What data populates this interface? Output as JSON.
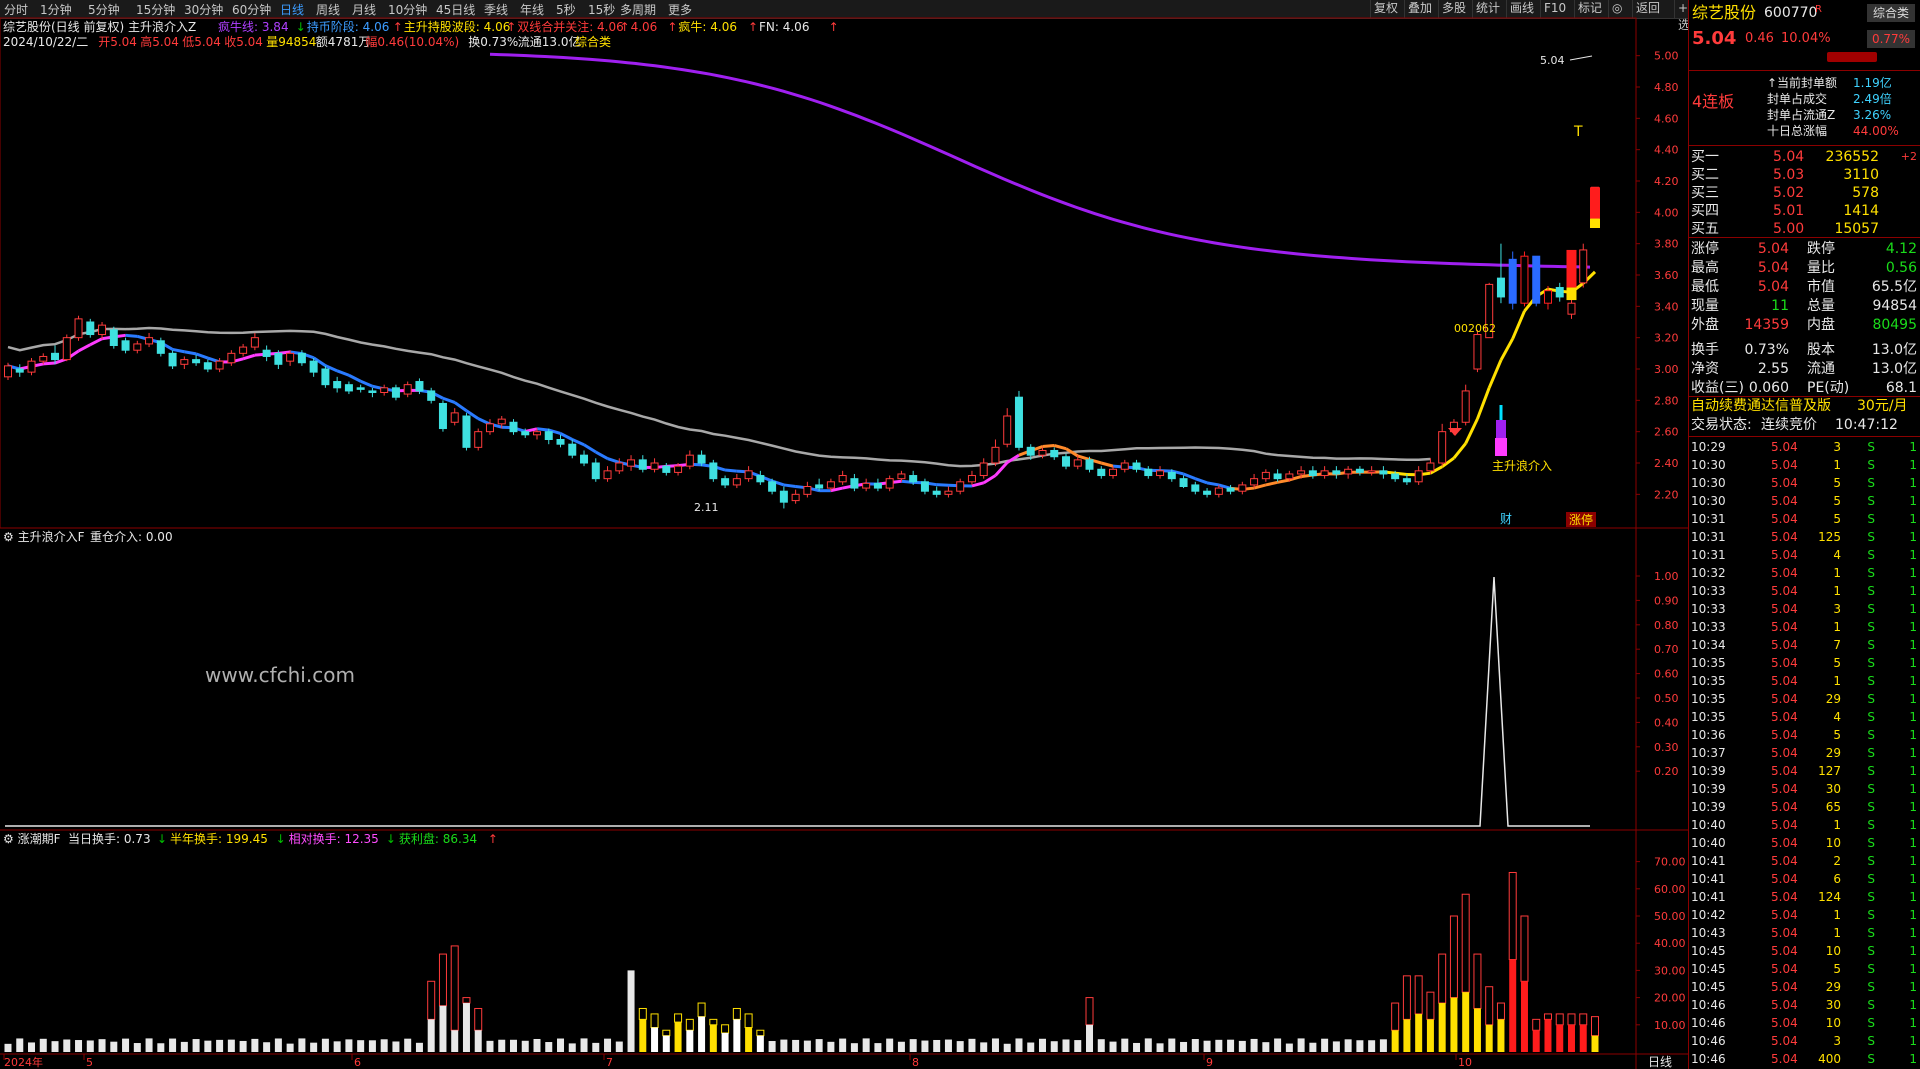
{
  "toolbar": {
    "periods": [
      "分时",
      "1分钟",
      "5分钟",
      "15分钟",
      "30分钟",
      "60分钟",
      "日线",
      "周线",
      "月线",
      "10分钟",
      "45日线",
      "季线",
      "年线",
      "5秒",
      "15秒",
      "多周期",
      "更多"
    ],
    "active_period": "日线",
    "right_buttons": [
      "复权",
      "叠加",
      "多股",
      "统计",
      "画线",
      "F10",
      "标记",
      "◎",
      "返回"
    ],
    "zixuan": "+自选"
  },
  "main_panel": {
    "title": "综艺股份(日线 前复权)",
    "indicator_name": "主升浪介入Z",
    "legend": [
      {
        "label": "疯牛线: 3.84",
        "color": "#b040ff"
      },
      {
        "label": "↓",
        "color": "#00c000"
      },
      {
        "label": "持币阶段: 4.06",
        "color": "#3c9cff"
      },
      {
        "label": "↑",
        "color": "#ff3b3b"
      },
      {
        "label": "主升持股波段: 4.06",
        "color": "#ffe000"
      },
      {
        "label": "↑",
        "color": "#ff3b3b"
      },
      {
        "label": "双线合并关注: 4.06",
        "color": "#ff3b3b"
      },
      {
        "label": "↑",
        "color": "#ff3b3b"
      },
      {
        "label": "4.06",
        "color": "#ff3b3b"
      },
      {
        "label": "↑",
        "color": "#ff3b3b"
      },
      {
        "label": "疯牛: 4.06",
        "color": "#ffe000"
      },
      {
        "label": "↑",
        "color": "#ff3b3b"
      },
      {
        "label": "FN: 4.06",
        "color": "#e8e8e8"
      },
      {
        "label": "↑",
        "color": "#ff3b3b"
      }
    ],
    "info_line": [
      {
        "label": "2024/10/22/二",
        "color": "#e8e8e8"
      },
      {
        "label": "开5.04",
        "color": "#ff3b3b"
      },
      {
        "label": "高5.04",
        "color": "#ff3b3b"
      },
      {
        "label": "低5.04",
        "color": "#ff3b3b"
      },
      {
        "label": "收5.04",
        "color": "#ff3b3b"
      },
      {
        "label": "量94854",
        "color": "#ffe000"
      },
      {
        "label": "额4781万",
        "color": "#e8e8e8"
      },
      {
        "label": "幅0.46(10.04%)",
        "color": "#ff3b3b"
      },
      {
        "label": "换0.73%",
        "color": "#e8e8e8"
      },
      {
        "label": "流通13.0亿",
        "color": "#e8e8e8"
      },
      {
        "label": "综合类",
        "color": "#ffe000"
      }
    ],
    "yaxis": [
      "5.00",
      "4.80",
      "4.60",
      "4.40",
      "4.20",
      "4.00",
      "3.80",
      "3.60",
      "3.40",
      "3.20",
      "3.00",
      "2.80",
      "2.60",
      "2.40",
      "2.20"
    ],
    "annotations": {
      "high_label": "5.04",
      "low_label": "2.11",
      "mid_label": "002062",
      "signal_label": "主升浪介入",
      "cai": "财",
      "zhangting": "涨停"
    }
  },
  "panel2": {
    "title": "主升浪介入F",
    "legend": "重仓介入: 0.00",
    "yaxis": [
      "1.00",
      "0.90",
      "0.80",
      "0.70",
      "0.60",
      "0.50",
      "0.40",
      "0.30",
      "0.20"
    ],
    "watermark": "www.cfchi.com",
    "peak_value": 1.0
  },
  "panel3": {
    "title": "涨潮期F",
    "legend": [
      {
        "label": "当日换手: 0.73",
        "color": "#e8e8e8"
      },
      {
        "label": "↓",
        "color": "#00c000"
      },
      {
        "label": "半年换手: 199.45",
        "color": "#ffe000"
      },
      {
        "label": "↓",
        "color": "#00c000"
      },
      {
        "label": "相对换手: 12.35",
        "color": "#ff4cff"
      },
      {
        "label": "↓",
        "color": "#00c000"
      },
      {
        "label": "获利盘: 86.34",
        "color": "#1adc1a"
      },
      {
        "label": "↑",
        "color": "#ff3b3b"
      }
    ],
    "yaxis": [
      "70.00",
      "60.00",
      "50.00",
      "40.00",
      "30.00",
      "20.00",
      "10.00"
    ],
    "xaxis": [
      {
        "label": "2024年",
        "pos": 0
      },
      {
        "label": "5",
        "pos": 1
      },
      {
        "label": "6",
        "pos": 2
      },
      {
        "label": "7",
        "pos": 3
      },
      {
        "label": "8",
        "pos": 4
      },
      {
        "label": "9",
        "pos": 5
      },
      {
        "label": "10",
        "pos": 6
      }
    ],
    "xaxis_right": "日线"
  },
  "quote": {
    "name": "综艺股份",
    "code": "600770",
    "code_flag": "R",
    "badge": "综合类",
    "price": "5.04",
    "change": "0.46",
    "pct": "10.04%",
    "badge_pct": "0.77%",
    "lianban": "4连板",
    "seal": [
      {
        "k": "当前封单额",
        "v": "1.19亿",
        "c": "cyan"
      },
      {
        "k": "封单占成交",
        "v": "2.49倍",
        "c": "cyan"
      },
      {
        "k": "封单占流通Z",
        "v": "3.26%",
        "c": "cyan"
      },
      {
        "k": "十日总涨幅",
        "v": "44.00%",
        "c": "red"
      }
    ],
    "bids": [
      {
        "k": "买一",
        "p": "5.04",
        "v": "236552",
        "d": "+2"
      },
      {
        "k": "买二",
        "p": "5.03",
        "v": "3110",
        "d": ""
      },
      {
        "k": "买三",
        "p": "5.02",
        "v": "578",
        "d": ""
      },
      {
        "k": "买四",
        "p": "5.01",
        "v": "1414",
        "d": ""
      },
      {
        "k": "买五",
        "p": "5.00",
        "v": "15057",
        "d": ""
      }
    ],
    "stats": [
      {
        "k1": "涨停",
        "v1": "5.04",
        "c1": "red",
        "k2": "跌停",
        "v2": "4.12",
        "c2": "green"
      },
      {
        "k1": "最高",
        "v1": "5.04",
        "c1": "red",
        "k2": "量比",
        "v2": "0.56",
        "c2": "green"
      },
      {
        "k1": "最低",
        "v1": "5.04",
        "c1": "red",
        "k2": "市值",
        "v2": "65.5亿",
        "c2": "white"
      },
      {
        "k1": "现量",
        "v1": "11",
        "c1": "green",
        "k2": "总量",
        "v2": "94854",
        "c2": "white"
      },
      {
        "k1": "外盘",
        "v1": "14359",
        "c1": "red",
        "k2": "内盘",
        "v2": "80495",
        "c2": "green"
      },
      {
        "k1": "换手",
        "v1": "0.73%",
        "c1": "white",
        "k2": "股本",
        "v2": "13.0亿",
        "c2": "white"
      },
      {
        "k1": "净资",
        "v1": "2.55",
        "c1": "white",
        "k2": "流通",
        "v2": "13.0亿",
        "c2": "white"
      },
      {
        "k1": "收益(三)",
        "v1": "0.060",
        "c1": "white",
        "k2": "PE(动)",
        "v2": "68.1",
        "c2": "white"
      }
    ],
    "promo": "自动续费通达信普及版",
    "promo_price": "30元/月",
    "trade_state_label": "交易状态:",
    "trade_state": "连续竞价",
    "trade_time": "10:47:12",
    "ticks": [
      [
        "10:29",
        "5.04",
        "3",
        "S",
        "1"
      ],
      [
        "10:30",
        "5.04",
        "1",
        "S",
        "1"
      ],
      [
        "10:30",
        "5.04",
        "5",
        "S",
        "1"
      ],
      [
        "10:30",
        "5.04",
        "5",
        "S",
        "1"
      ],
      [
        "10:31",
        "5.04",
        "5",
        "S",
        "1"
      ],
      [
        "10:31",
        "5.04",
        "125",
        "S",
        "1"
      ],
      [
        "10:31",
        "5.04",
        "4",
        "S",
        "1"
      ],
      [
        "10:32",
        "5.04",
        "1",
        "S",
        "1"
      ],
      [
        "10:33",
        "5.04",
        "1",
        "S",
        "1"
      ],
      [
        "10:33",
        "5.04",
        "3",
        "S",
        "1"
      ],
      [
        "10:33",
        "5.04",
        "1",
        "S",
        "1"
      ],
      [
        "10:34",
        "5.04",
        "7",
        "S",
        "1"
      ],
      [
        "10:35",
        "5.04",
        "5",
        "S",
        "1"
      ],
      [
        "10:35",
        "5.04",
        "1",
        "S",
        "1"
      ],
      [
        "10:35",
        "5.04",
        "29",
        "S",
        "1"
      ],
      [
        "10:35",
        "5.04",
        "4",
        "S",
        "1"
      ],
      [
        "10:36",
        "5.04",
        "5",
        "S",
        "1"
      ],
      [
        "10:37",
        "5.04",
        "29",
        "S",
        "1"
      ],
      [
        "10:39",
        "5.04",
        "127",
        "S",
        "1"
      ],
      [
        "10:39",
        "5.04",
        "30",
        "S",
        "1"
      ],
      [
        "10:39",
        "5.04",
        "65",
        "S",
        "1"
      ],
      [
        "10:40",
        "5.04",
        "1",
        "S",
        "1"
      ],
      [
        "10:40",
        "5.04",
        "10",
        "S",
        "1"
      ],
      [
        "10:41",
        "5.04",
        "2",
        "S",
        "1"
      ],
      [
        "10:41",
        "5.04",
        "6",
        "S",
        "1"
      ],
      [
        "10:41",
        "5.04",
        "124",
        "S",
        "1"
      ],
      [
        "10:42",
        "5.04",
        "1",
        "S",
        "1"
      ],
      [
        "10:43",
        "5.04",
        "1",
        "S",
        "1"
      ],
      [
        "10:45",
        "5.04",
        "10",
        "S",
        "1"
      ],
      [
        "10:45",
        "5.04",
        "5",
        "S",
        "1"
      ],
      [
        "10:45",
        "5.04",
        "29",
        "S",
        "1"
      ],
      [
        "10:46",
        "5.04",
        "30",
        "S",
        "1"
      ],
      [
        "10:46",
        "5.04",
        "10",
        "S",
        "1"
      ],
      [
        "10:46",
        "5.04",
        "3",
        "S",
        "1"
      ],
      [
        "10:46",
        "5.04",
        "400",
        "S",
        "1"
      ]
    ]
  },
  "chart_data": {
    "type": "candlestick",
    "ylim": [
      2.1,
      5.1
    ],
    "candles": [
      [
        2.95,
        3.02,
        3.04,
        2.93
      ],
      [
        3.0,
        2.98,
        3.03,
        2.95
      ],
      [
        2.98,
        3.05,
        3.07,
        2.96
      ],
      [
        3.05,
        3.08,
        3.1,
        3.03
      ],
      [
        3.1,
        3.06,
        3.15,
        3.03
      ],
      [
        3.06,
        3.2,
        3.22,
        3.05
      ],
      [
        3.2,
        3.32,
        3.34,
        3.18
      ],
      [
        3.3,
        3.22,
        3.32,
        3.2
      ],
      [
        3.22,
        3.28,
        3.3,
        3.19
      ],
      [
        3.25,
        3.15,
        3.27,
        3.13
      ],
      [
        3.18,
        3.12,
        3.2,
        3.1
      ],
      [
        3.12,
        3.16,
        3.18,
        3.1
      ],
      [
        3.16,
        3.2,
        3.23,
        3.14
      ],
      [
        3.18,
        3.1,
        3.2,
        3.08
      ],
      [
        3.1,
        3.02,
        3.12,
        3.0
      ],
      [
        3.03,
        3.06,
        3.08,
        3.0
      ],
      [
        3.06,
        3.04,
        3.09,
        3.02
      ],
      [
        3.04,
        3.0,
        3.06,
        2.98
      ],
      [
        3.0,
        3.05,
        3.07,
        2.98
      ],
      [
        3.04,
        3.1,
        3.12,
        3.02
      ],
      [
        3.1,
        3.14,
        3.16,
        3.08
      ],
      [
        3.14,
        3.2,
        3.23,
        3.12
      ],
      [
        3.12,
        3.08,
        3.15,
        3.05
      ],
      [
        3.1,
        3.03,
        3.12,
        3.0
      ],
      [
        3.05,
        3.1,
        3.12,
        3.02
      ],
      [
        3.1,
        3.04,
        3.12,
        3.02
      ],
      [
        3.05,
        2.98,
        3.07,
        2.95
      ],
      [
        3.0,
        2.9,
        3.02,
        2.88
      ],
      [
        2.92,
        2.88,
        2.95,
        2.85
      ],
      [
        2.9,
        2.86,
        2.92,
        2.84
      ],
      [
        2.88,
        2.87,
        2.9,
        2.85
      ],
      [
        2.86,
        2.85,
        2.88,
        2.82
      ],
      [
        2.85,
        2.88,
        2.9,
        2.83
      ],
      [
        2.88,
        2.82,
        2.9,
        2.8
      ],
      [
        2.84,
        2.9,
        2.92,
        2.82
      ],
      [
        2.92,
        2.86,
        2.94,
        2.84
      ],
      [
        2.86,
        2.8,
        2.88,
        2.78
      ],
      [
        2.78,
        2.62,
        2.8,
        2.6
      ],
      [
        2.66,
        2.72,
        2.75,
        2.64
      ],
      [
        2.7,
        2.5,
        2.72,
        2.48
      ],
      [
        2.5,
        2.6,
        2.62,
        2.48
      ],
      [
        2.6,
        2.65,
        2.68,
        2.58
      ],
      [
        2.65,
        2.68,
        2.7,
        2.62
      ],
      [
        2.66,
        2.6,
        2.68,
        2.58
      ],
      [
        2.6,
        2.58,
        2.62,
        2.56
      ],
      [
        2.58,
        2.6,
        2.62,
        2.55
      ],
      [
        2.6,
        2.55,
        2.62,
        2.52
      ],
      [
        2.55,
        2.52,
        2.58,
        2.5
      ],
      [
        2.52,
        2.45,
        2.55,
        2.43
      ],
      [
        2.45,
        2.4,
        2.48,
        2.38
      ],
      [
        2.4,
        2.3,
        2.43,
        2.28
      ],
      [
        2.3,
        2.35,
        2.38,
        2.28
      ],
      [
        2.35,
        2.4,
        2.43,
        2.33
      ],
      [
        2.38,
        2.42,
        2.45,
        2.35
      ],
      [
        2.42,
        2.36,
        2.45,
        2.34
      ],
      [
        2.36,
        2.4,
        2.43,
        2.34
      ],
      [
        2.38,
        2.34,
        2.4,
        2.32
      ],
      [
        2.34,
        2.38,
        2.4,
        2.32
      ],
      [
        2.38,
        2.45,
        2.48,
        2.36
      ],
      [
        2.45,
        2.4,
        2.48,
        2.38
      ],
      [
        2.4,
        2.3,
        2.42,
        2.28
      ],
      [
        2.3,
        2.26,
        2.32,
        2.24
      ],
      [
        2.26,
        2.3,
        2.33,
        2.24
      ],
      [
        2.3,
        2.35,
        2.38,
        2.28
      ],
      [
        2.32,
        2.28,
        2.35,
        2.26
      ],
      [
        2.28,
        2.22,
        2.3,
        2.2
      ],
      [
        2.22,
        2.15,
        2.25,
        2.11
      ],
      [
        2.16,
        2.2,
        2.23,
        2.14
      ],
      [
        2.2,
        2.25,
        2.28,
        2.18
      ],
      [
        2.26,
        2.24,
        2.3,
        2.22
      ],
      [
        2.24,
        2.28,
        2.3,
        2.22
      ],
      [
        2.28,
        2.32,
        2.35,
        2.26
      ],
      [
        2.3,
        2.24,
        2.33,
        2.22
      ],
      [
        2.24,
        2.27,
        2.3,
        2.22
      ],
      [
        2.27,
        2.24,
        2.3,
        2.22
      ],
      [
        2.24,
        2.3,
        2.32,
        2.22
      ],
      [
        2.3,
        2.33,
        2.35,
        2.28
      ],
      [
        2.32,
        2.28,
        2.35,
        2.26
      ],
      [
        2.28,
        2.22,
        2.3,
        2.2
      ],
      [
        2.22,
        2.2,
        2.25,
        2.18
      ],
      [
        2.2,
        2.22,
        2.25,
        2.18
      ],
      [
        2.22,
        2.28,
        2.3,
        2.2
      ],
      [
        2.28,
        2.32,
        2.35,
        2.26
      ],
      [
        2.32,
        2.4,
        2.43,
        2.3
      ],
      [
        2.4,
        2.5,
        2.55,
        2.38
      ],
      [
        2.52,
        2.7,
        2.75,
        2.5
      ],
      [
        2.82,
        2.5,
        2.86,
        2.48
      ],
      [
        2.5,
        2.45,
        2.52,
        2.42
      ],
      [
        2.45,
        2.48,
        2.5,
        2.43
      ],
      [
        2.48,
        2.44,
        2.5,
        2.42
      ],
      [
        2.44,
        2.38,
        2.46,
        2.36
      ],
      [
        2.38,
        2.42,
        2.45,
        2.36
      ],
      [
        2.42,
        2.36,
        2.44,
        2.34
      ],
      [
        2.36,
        2.32,
        2.38,
        2.3
      ],
      [
        2.32,
        2.36,
        2.38,
        2.3
      ],
      [
        2.36,
        2.4,
        2.42,
        2.34
      ],
      [
        2.4,
        2.36,
        2.42,
        2.34
      ],
      [
        2.36,
        2.32,
        2.38,
        2.3
      ],
      [
        2.32,
        2.35,
        2.38,
        2.3
      ],
      [
        2.34,
        2.3,
        2.36,
        2.28
      ],
      [
        2.3,
        2.25,
        2.32,
        2.24
      ],
      [
        2.26,
        2.22,
        2.28,
        2.2
      ],
      [
        2.22,
        2.2,
        2.24,
        2.18
      ],
      [
        2.2,
        2.24,
        2.26,
        2.18
      ],
      [
        2.24,
        2.22,
        2.26,
        2.2
      ],
      [
        2.22,
        2.26,
        2.28,
        2.2
      ],
      [
        2.26,
        2.3,
        2.33,
        2.24
      ],
      [
        2.3,
        2.34,
        2.36,
        2.28
      ],
      [
        2.33,
        2.3,
        2.36,
        2.28
      ],
      [
        2.3,
        2.33,
        2.35,
        2.28
      ],
      [
        2.33,
        2.35,
        2.38,
        2.3
      ],
      [
        2.35,
        2.32,
        2.38,
        2.3
      ],
      [
        2.32,
        2.35,
        2.38,
        2.3
      ],
      [
        2.35,
        2.33,
        2.38,
        2.3
      ],
      [
        2.33,
        2.36,
        2.38,
        2.3
      ],
      [
        2.36,
        2.34,
        2.38,
        2.32
      ],
      [
        2.34,
        2.35,
        2.38,
        2.32
      ],
      [
        2.35,
        2.33,
        2.38,
        2.3
      ],
      [
        2.33,
        2.3,
        2.35,
        2.28
      ],
      [
        2.3,
        2.28,
        2.33,
        2.26
      ],
      [
        2.28,
        2.35,
        2.38,
        2.26
      ],
      [
        2.35,
        2.4,
        2.43,
        2.33
      ],
      [
        2.4,
        2.6,
        2.65,
        2.38
      ],
      [
        2.6,
        2.66,
        2.68,
        2.58
      ],
      [
        2.66,
        2.86,
        2.9,
        2.64
      ],
      [
        3.0,
        3.22,
        3.25,
        2.98
      ],
      [
        3.2,
        3.54,
        3.55,
        3.3
      ],
      [
        3.58,
        3.46,
        3.8,
        3.42
      ],
      [
        3.7,
        3.42,
        3.75,
        3.38
      ],
      [
        3.42,
        3.72,
        3.75,
        3.4
      ],
      [
        3.72,
        3.42,
        3.72,
        3.4
      ],
      [
        3.42,
        3.5,
        3.53,
        3.38
      ],
      [
        3.52,
        3.46,
        3.55,
        3.43
      ],
      [
        3.35,
        3.42,
        3.45,
        3.32
      ],
      [
        3.55,
        3.76,
        3.8,
        3.52
      ],
      [
        3.96,
        4.16,
        4.16,
        3.96
      ]
    ],
    "ma_purple": {
      "name": "疯牛线",
      "start_price": 5.04,
      "end_price": 3.64
    },
    "indicator_peak": {
      "type": "line",
      "x_index": 126,
      "value": 1.0
    },
    "volume_bars_note": "turnover bars per day; tall red/yellow bars at the right end"
  }
}
